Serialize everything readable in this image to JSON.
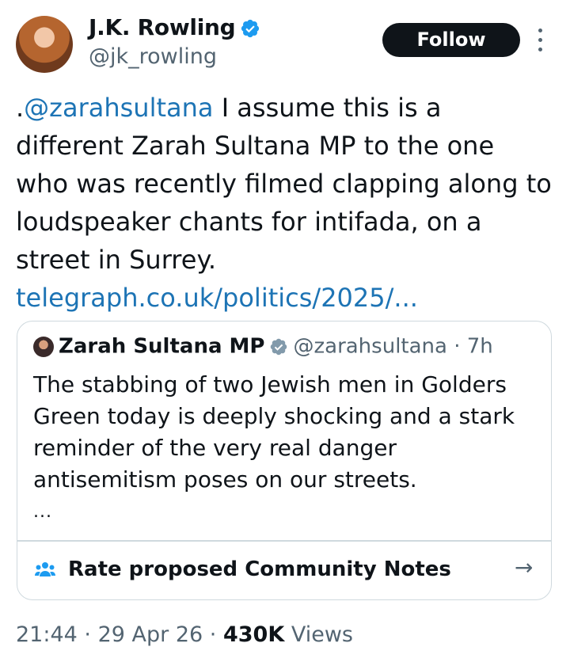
{
  "author": {
    "name": "J.K. Rowling",
    "handle": "@jk_rowling",
    "follow_label": "Follow"
  },
  "tweet": {
    "prefix": ".",
    "mention": "@zarahsultana",
    "text": " I assume this is a different Zarah Sultana MP to the one who was recently filmed clapping along to loudspeaker chants for intifada, on a street in Surrey.",
    "link": "telegraph.co.uk/politics/2025/..."
  },
  "quote": {
    "name": "Zarah Sultana MP",
    "handle": "@zarahsultana",
    "separator": "·",
    "time": "7h",
    "text": "The stabbing of two Jewish men in Golders Green today is deeply shocking and a stark reminder of the very real danger antisemitism poses on our streets.",
    "ellipsis": "...",
    "notes_label": "Rate proposed Community Notes",
    "notes_arrow": "→"
  },
  "meta": {
    "time": "21:44",
    "sep1": "·",
    "date": "29 Apr 26",
    "sep2": "·",
    "views_count": "430K",
    "views_label": "Views"
  },
  "colors": {
    "link": "#1d74b5",
    "verified": "#1d9bf0",
    "quote_verified": "#829aab",
    "text": "#0f1419",
    "muted": "#536471"
  }
}
